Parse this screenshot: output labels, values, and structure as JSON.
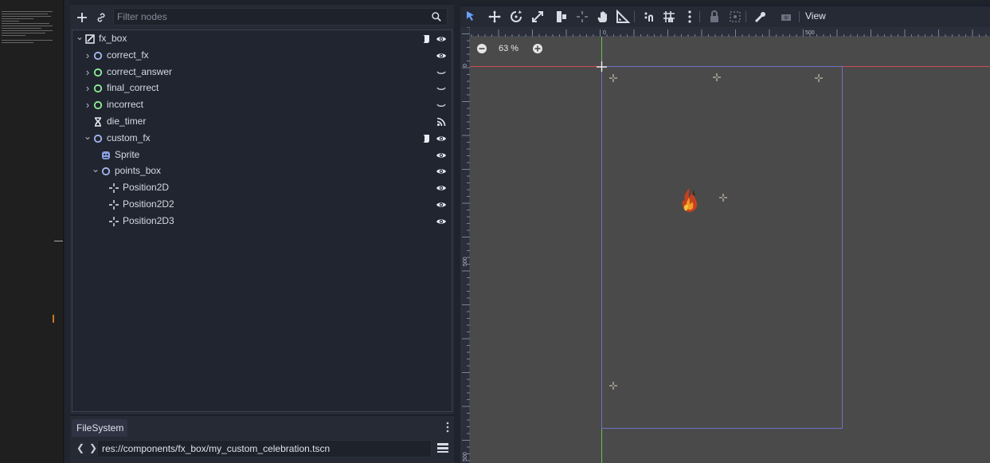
{
  "scene_dock": {
    "filter_placeholder": "Filter nodes",
    "nodes": [
      {
        "name": "fx_box",
        "icon": "node2d-icon",
        "depth": 0,
        "expanded": "open",
        "right_icons": [
          "script-icon",
          "eye-icon"
        ]
      },
      {
        "name": "correct_fx",
        "icon": "node2d-circle-icon",
        "depth": 1,
        "expanded": "closed",
        "right_icons": [
          "eye-icon"
        ]
      },
      {
        "name": "correct_answer",
        "icon": "audio-circle-icon",
        "depth": 1,
        "expanded": "closed",
        "right_icons": [
          "visibility-closed-icon"
        ]
      },
      {
        "name": "final_correct",
        "icon": "audio-circle-icon",
        "depth": 1,
        "expanded": "closed",
        "right_icons": [
          "visibility-closed-icon"
        ]
      },
      {
        "name": "incorrect",
        "icon": "audio-circle-icon",
        "depth": 1,
        "expanded": "closed",
        "right_icons": [
          "visibility-closed-icon"
        ]
      },
      {
        "name": "die_timer",
        "icon": "timer-icon",
        "depth": 1,
        "expanded": "none",
        "right_icons": [
          "signal-icon"
        ]
      },
      {
        "name": "custom_fx",
        "icon": "node2d-circle-icon",
        "depth": 1,
        "expanded": "open",
        "right_icons": [
          "script-icon",
          "eye-icon"
        ]
      },
      {
        "name": "Sprite",
        "icon": "sprite-icon",
        "depth": 2,
        "expanded": "none",
        "right_icons": [
          "eye-icon"
        ]
      },
      {
        "name": "points_box",
        "icon": "node2d-circle-icon",
        "depth": 2,
        "expanded": "open",
        "right_icons": [
          "eye-icon"
        ]
      },
      {
        "name": "Position2D",
        "icon": "position2d-icon",
        "depth": 3,
        "expanded": "none",
        "right_icons": [
          "eye-icon"
        ]
      },
      {
        "name": "Position2D2",
        "icon": "position2d-icon",
        "depth": 3,
        "expanded": "none",
        "right_icons": [
          "eye-icon"
        ]
      },
      {
        "name": "Position2D3",
        "icon": "position2d-icon",
        "depth": 3,
        "expanded": "none",
        "right_icons": [
          "eye-icon"
        ]
      }
    ]
  },
  "filesystem": {
    "tab_label": "FileSystem",
    "path": "res://components/fx_box/my_custom_celebration.tscn"
  },
  "viewport": {
    "view_menu": "View",
    "zoom": "63 %",
    "ruler_top_labels": [
      "0",
      "500"
    ],
    "ruler_left_labels": [
      "0",
      "500",
      "500"
    ],
    "tools": [
      "select-icon",
      "move-icon",
      "rotate-icon",
      "scale-icon",
      "list-select-icon",
      "pivot-icon",
      "pan-icon",
      "ruler-icon",
      "smart-snap-icon",
      "grid-snap-icon",
      "snap-options-icon",
      "lock-icon",
      "group-icon",
      "skeleton-icon",
      "camera-icon"
    ]
  },
  "colors": {
    "accent": "#6ba1ff",
    "node_circle": "#a5b7f3",
    "audio_circle": "#8eef97",
    "canvas": "#4a4a4a",
    "x_axis": "#cc4b55",
    "y_axis": "#6cbf5a",
    "screen_rect": "#7878d8"
  }
}
